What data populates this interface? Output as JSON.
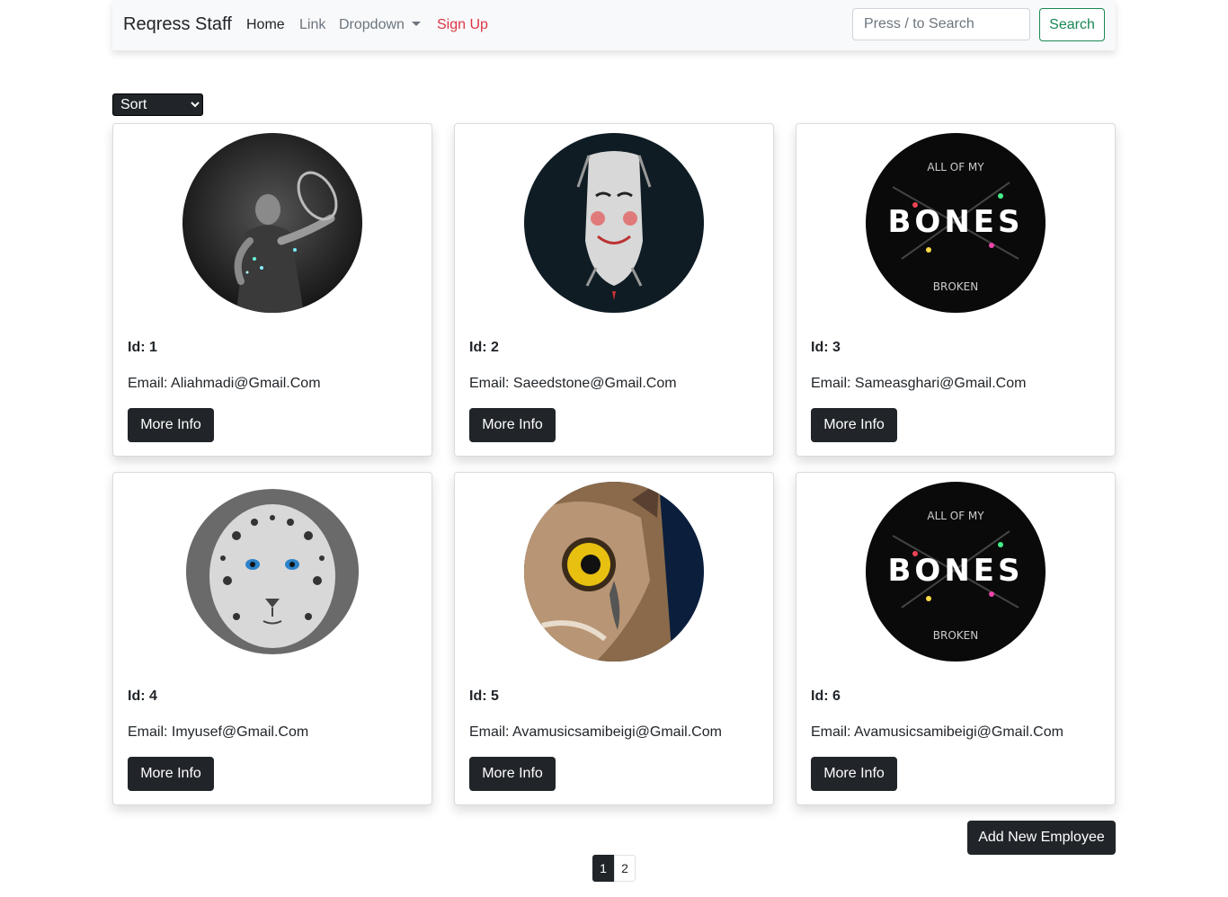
{
  "navbar": {
    "brand": "Reqress Staff",
    "links": {
      "home": "Home",
      "link": "Link",
      "dropdown": "Dropdown",
      "signup": "Sign Up"
    },
    "search_placeholder": "Press / to Search",
    "search_button": "Search"
  },
  "sort": {
    "selected": "Sort"
  },
  "employees": [
    {
      "id_text": "Id: 1",
      "email_text": "Email: Aliahmadi@Gmail.Com",
      "button": "More Info",
      "avatar_icon": "tennis-player-photo"
    },
    {
      "id_text": "Id: 2",
      "email_text": "Email: Saeedstone@Gmail.Com",
      "button": "More Info",
      "avatar_icon": "mask-art-photo"
    },
    {
      "id_text": "Id: 3",
      "email_text": "Email: Sameasghari@Gmail.Com",
      "button": "More Info",
      "avatar_icon": "bones-album-art"
    },
    {
      "id_text": "Id: 4",
      "email_text": "Email: Imyusef@Gmail.Com",
      "button": "More Info",
      "avatar_icon": "snow-leopard-photo"
    },
    {
      "id_text": "Id: 5",
      "email_text": "Email: Avamusicsamibeigi@Gmail.Com",
      "button": "More Info",
      "avatar_icon": "owl-photo"
    },
    {
      "id_text": "Id: 6",
      "email_text": "Email: Avamusicsamibeigi@Gmail.Com",
      "button": "More Info",
      "avatar_icon": "bones-album-art"
    }
  ],
  "bones_art": {
    "top": "ALL OF MY",
    "main": "BONES",
    "bottom": "BROKEN"
  },
  "add_button": "Add New Employee",
  "pagination": {
    "pages": [
      "1",
      "2"
    ],
    "current": "1"
  },
  "colors": {
    "dark": "#212529",
    "success": "#198754",
    "danger": "#dc3545",
    "muted": "#6c757d",
    "navbar_bg": "#f8f9fa"
  }
}
